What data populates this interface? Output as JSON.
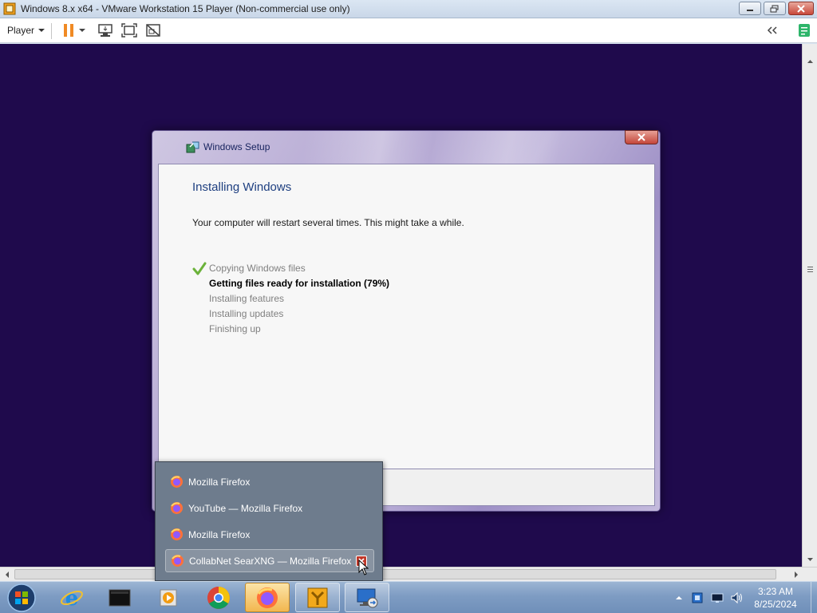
{
  "window": {
    "title": "Windows 8.x x64 - VMware Workstation 15 Player (Non-commercial use only)",
    "icon": "vmware-player-icon",
    "controls": [
      "minimize-icon",
      "restore-icon",
      "close-icon"
    ]
  },
  "toolbar": {
    "player_menu": "Player",
    "icons": [
      "pause-icon",
      "dropdown-arrow-icon",
      "send-ctrl-alt-del-icon",
      "fullscreen-icon",
      "unity-icon",
      "collapse-toolbar-icon",
      "notes-icon"
    ],
    "pause_color": "#f08a24"
  },
  "guest": {
    "background": "#1f0a4c"
  },
  "setup": {
    "title": "Windows Setup",
    "heading": "Installing Windows",
    "description": "Your computer will restart several times. This might take a while.",
    "steps": [
      {
        "label": "Copying Windows files",
        "state": "done"
      },
      {
        "label": "Getting files ready for installation (79%)",
        "state": "active"
      },
      {
        "label": "Installing features",
        "state": "pending"
      },
      {
        "label": "Installing updates",
        "state": "pending"
      },
      {
        "label": "Finishing up",
        "state": "pending"
      }
    ],
    "progress_percent": 79
  },
  "popup": {
    "items": [
      {
        "label": "Mozilla Firefox",
        "icon": "firefox-icon"
      },
      {
        "label": "YouTube — Mozilla Firefox",
        "icon": "firefox-icon"
      },
      {
        "label": "Mozilla Firefox",
        "icon": "firefox-icon"
      },
      {
        "label": "CollabNet SearXNG — Mozilla Firefox",
        "icon": "firefox-icon",
        "hover": true
      }
    ]
  },
  "taskbar": {
    "apps": [
      "internet-explorer-icon",
      "terminal-icon",
      "media-player-icon",
      "chrome-icon",
      "firefox-icon",
      "vmware-icon",
      "remote-desktop-icon"
    ],
    "tray_icons": [
      "show-hidden-icons-arrow",
      "vmware-tray-icon",
      "network-icon",
      "volume-icon"
    ],
    "time": "3:23 AM",
    "date": "8/25/2024"
  }
}
